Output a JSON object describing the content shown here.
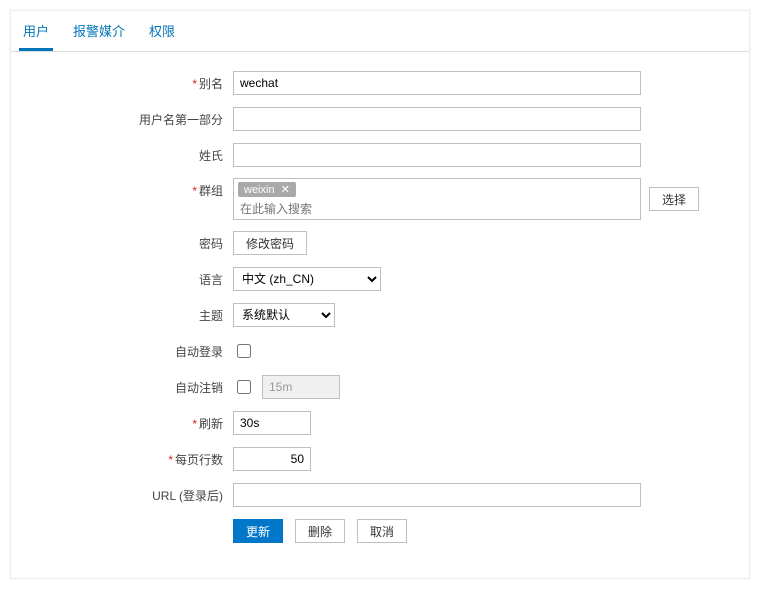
{
  "tabs": {
    "user": "用户",
    "media": "报警媒介",
    "perm": "权限"
  },
  "labels": {
    "alias": "别名",
    "username_part": "用户名第一部分",
    "surname": "姓氏",
    "groups": "群组",
    "password": "密码",
    "language": "语言",
    "theme": "主题",
    "autologin": "自动登录",
    "autologout": "自动注销",
    "refresh": "刷新",
    "rows": "每页行数",
    "url": "URL (登录后)"
  },
  "values": {
    "alias": "wechat",
    "username_part": "",
    "surname": "",
    "group_tag": "weixin",
    "group_placeholder": "在此输入搜索",
    "autologout_val": "15m",
    "refresh_val": "30s",
    "rows_val": "50",
    "url_val": ""
  },
  "buttons": {
    "select": "选择",
    "changepw": "修改密码",
    "update": "更新",
    "delete": "删除",
    "cancel": "取消"
  },
  "selects": {
    "language": "中文 (zh_CN)",
    "theme": "系统默认"
  }
}
